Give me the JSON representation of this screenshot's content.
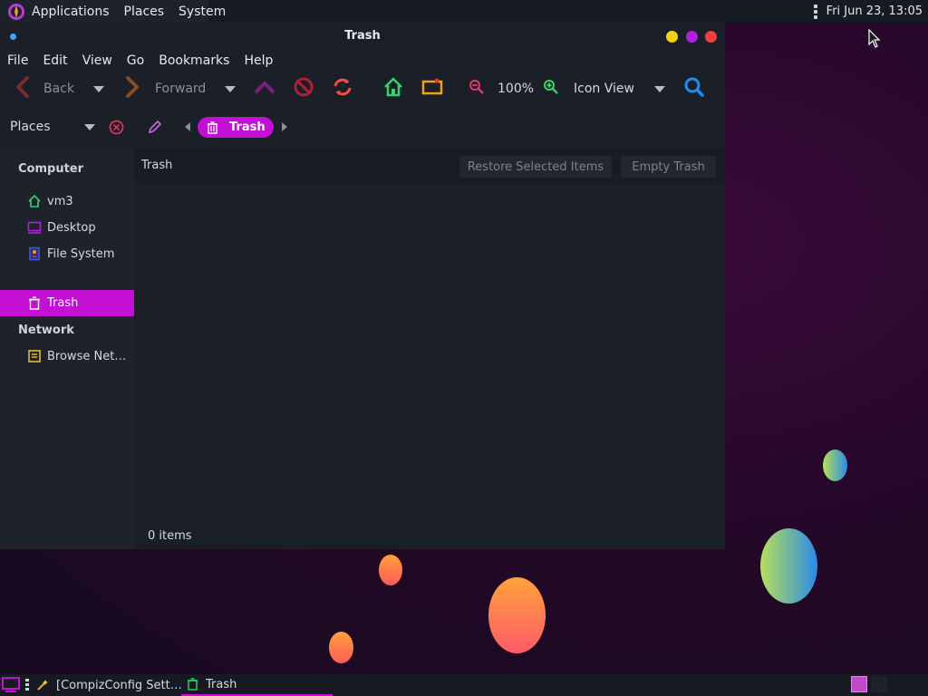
{
  "top_panel": {
    "menus": [
      "Applications",
      "Places",
      "System"
    ],
    "clock": "Fri Jun 23, 13:05"
  },
  "window": {
    "title": "Trash",
    "menubar": [
      "File",
      "Edit",
      "View",
      "Go",
      "Bookmarks",
      "Help"
    ],
    "toolbar": {
      "back_label": "Back",
      "forward_label": "Forward",
      "zoom_level": "100%",
      "view_mode": "Icon View"
    },
    "location": {
      "sidebar_mode": "Places",
      "current_crumb": "Trash"
    },
    "sidebar": {
      "sections": [
        {
          "heading": "Computer",
          "items": [
            {
              "label": "vm3",
              "icon": "home-icon"
            },
            {
              "label": "Desktop",
              "icon": "desktop-icon"
            },
            {
              "label": "File System",
              "icon": "drive-icon"
            },
            {
              "label": "Trash",
              "icon": "trash-icon",
              "active": true
            }
          ]
        },
        {
          "heading": "Network",
          "items": [
            {
              "label": "Browse Net…",
              "icon": "network-icon"
            }
          ]
        }
      ]
    },
    "content": {
      "header_label": "Trash",
      "restore_button": "Restore Selected Items",
      "empty_button": "Empty Trash",
      "status": "0 items"
    }
  },
  "taskbar": {
    "tasks": [
      {
        "label": "[CompizConfig Sett…",
        "icon": "wand-icon",
        "active": false
      },
      {
        "label": "Trash",
        "icon": "trash-icon",
        "active": true
      }
    ]
  },
  "colors": {
    "accent": "#c40fd5",
    "minimize": "#f2d20f",
    "maximize": "#b21fe0",
    "close": "#ef4040"
  }
}
